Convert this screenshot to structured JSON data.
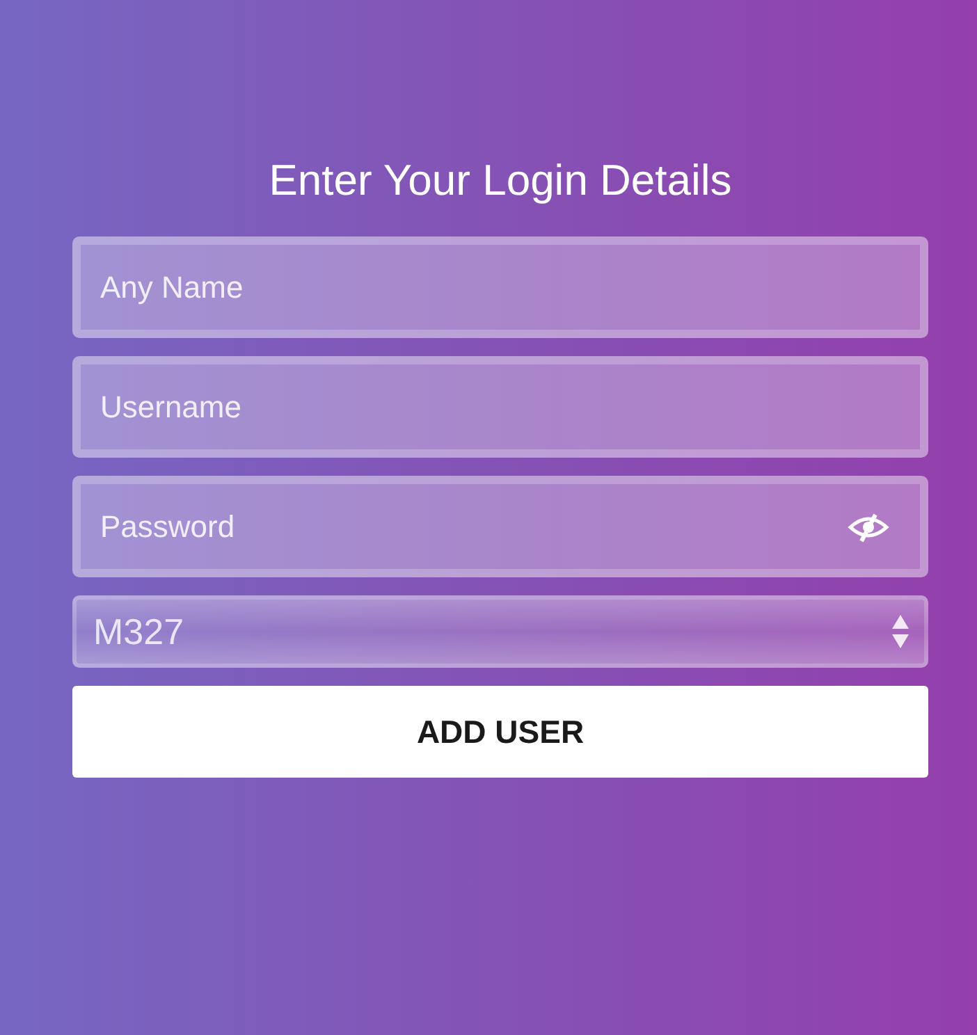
{
  "title": "Enter Your Login Details",
  "fields": [
    {
      "kind": "text",
      "placeholder": "Any Name"
    },
    {
      "kind": "text",
      "placeholder": "Username"
    },
    {
      "kind": "password",
      "placeholder": "Password"
    }
  ],
  "select": {
    "value": "M327"
  },
  "buttons": [
    "ADD USER"
  ]
}
